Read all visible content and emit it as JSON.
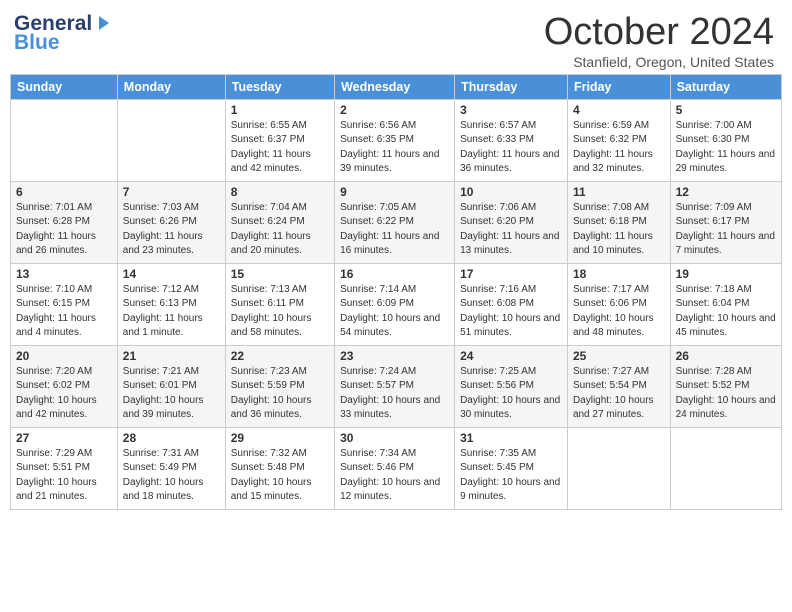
{
  "header": {
    "logo_general": "General",
    "logo_blue": "Blue",
    "month": "October 2024",
    "location": "Stanfield, Oregon, United States"
  },
  "days_of_week": [
    "Sunday",
    "Monday",
    "Tuesday",
    "Wednesday",
    "Thursday",
    "Friday",
    "Saturday"
  ],
  "weeks": [
    [
      {
        "day": "",
        "sunrise": "",
        "sunset": "",
        "daylight": ""
      },
      {
        "day": "",
        "sunrise": "",
        "sunset": "",
        "daylight": ""
      },
      {
        "day": "1",
        "sunrise": "Sunrise: 6:55 AM",
        "sunset": "Sunset: 6:37 PM",
        "daylight": "Daylight: 11 hours and 42 minutes."
      },
      {
        "day": "2",
        "sunrise": "Sunrise: 6:56 AM",
        "sunset": "Sunset: 6:35 PM",
        "daylight": "Daylight: 11 hours and 39 minutes."
      },
      {
        "day": "3",
        "sunrise": "Sunrise: 6:57 AM",
        "sunset": "Sunset: 6:33 PM",
        "daylight": "Daylight: 11 hours and 36 minutes."
      },
      {
        "day": "4",
        "sunrise": "Sunrise: 6:59 AM",
        "sunset": "Sunset: 6:32 PM",
        "daylight": "Daylight: 11 hours and 32 minutes."
      },
      {
        "day": "5",
        "sunrise": "Sunrise: 7:00 AM",
        "sunset": "Sunset: 6:30 PM",
        "daylight": "Daylight: 11 hours and 29 minutes."
      }
    ],
    [
      {
        "day": "6",
        "sunrise": "Sunrise: 7:01 AM",
        "sunset": "Sunset: 6:28 PM",
        "daylight": "Daylight: 11 hours and 26 minutes."
      },
      {
        "day": "7",
        "sunrise": "Sunrise: 7:03 AM",
        "sunset": "Sunset: 6:26 PM",
        "daylight": "Daylight: 11 hours and 23 minutes."
      },
      {
        "day": "8",
        "sunrise": "Sunrise: 7:04 AM",
        "sunset": "Sunset: 6:24 PM",
        "daylight": "Daylight: 11 hours and 20 minutes."
      },
      {
        "day": "9",
        "sunrise": "Sunrise: 7:05 AM",
        "sunset": "Sunset: 6:22 PM",
        "daylight": "Daylight: 11 hours and 16 minutes."
      },
      {
        "day": "10",
        "sunrise": "Sunrise: 7:06 AM",
        "sunset": "Sunset: 6:20 PM",
        "daylight": "Daylight: 11 hours and 13 minutes."
      },
      {
        "day": "11",
        "sunrise": "Sunrise: 7:08 AM",
        "sunset": "Sunset: 6:18 PM",
        "daylight": "Daylight: 11 hours and 10 minutes."
      },
      {
        "day": "12",
        "sunrise": "Sunrise: 7:09 AM",
        "sunset": "Sunset: 6:17 PM",
        "daylight": "Daylight: 11 hours and 7 minutes."
      }
    ],
    [
      {
        "day": "13",
        "sunrise": "Sunrise: 7:10 AM",
        "sunset": "Sunset: 6:15 PM",
        "daylight": "Daylight: 11 hours and 4 minutes."
      },
      {
        "day": "14",
        "sunrise": "Sunrise: 7:12 AM",
        "sunset": "Sunset: 6:13 PM",
        "daylight": "Daylight: 11 hours and 1 minute."
      },
      {
        "day": "15",
        "sunrise": "Sunrise: 7:13 AM",
        "sunset": "Sunset: 6:11 PM",
        "daylight": "Daylight: 10 hours and 58 minutes."
      },
      {
        "day": "16",
        "sunrise": "Sunrise: 7:14 AM",
        "sunset": "Sunset: 6:09 PM",
        "daylight": "Daylight: 10 hours and 54 minutes."
      },
      {
        "day": "17",
        "sunrise": "Sunrise: 7:16 AM",
        "sunset": "Sunset: 6:08 PM",
        "daylight": "Daylight: 10 hours and 51 minutes."
      },
      {
        "day": "18",
        "sunrise": "Sunrise: 7:17 AM",
        "sunset": "Sunset: 6:06 PM",
        "daylight": "Daylight: 10 hours and 48 minutes."
      },
      {
        "day": "19",
        "sunrise": "Sunrise: 7:18 AM",
        "sunset": "Sunset: 6:04 PM",
        "daylight": "Daylight: 10 hours and 45 minutes."
      }
    ],
    [
      {
        "day": "20",
        "sunrise": "Sunrise: 7:20 AM",
        "sunset": "Sunset: 6:02 PM",
        "daylight": "Daylight: 10 hours and 42 minutes."
      },
      {
        "day": "21",
        "sunrise": "Sunrise: 7:21 AM",
        "sunset": "Sunset: 6:01 PM",
        "daylight": "Daylight: 10 hours and 39 minutes."
      },
      {
        "day": "22",
        "sunrise": "Sunrise: 7:23 AM",
        "sunset": "Sunset: 5:59 PM",
        "daylight": "Daylight: 10 hours and 36 minutes."
      },
      {
        "day": "23",
        "sunrise": "Sunrise: 7:24 AM",
        "sunset": "Sunset: 5:57 PM",
        "daylight": "Daylight: 10 hours and 33 minutes."
      },
      {
        "day": "24",
        "sunrise": "Sunrise: 7:25 AM",
        "sunset": "Sunset: 5:56 PM",
        "daylight": "Daylight: 10 hours and 30 minutes."
      },
      {
        "day": "25",
        "sunrise": "Sunrise: 7:27 AM",
        "sunset": "Sunset: 5:54 PM",
        "daylight": "Daylight: 10 hours and 27 minutes."
      },
      {
        "day": "26",
        "sunrise": "Sunrise: 7:28 AM",
        "sunset": "Sunset: 5:52 PM",
        "daylight": "Daylight: 10 hours and 24 minutes."
      }
    ],
    [
      {
        "day": "27",
        "sunrise": "Sunrise: 7:29 AM",
        "sunset": "Sunset: 5:51 PM",
        "daylight": "Daylight: 10 hours and 21 minutes."
      },
      {
        "day": "28",
        "sunrise": "Sunrise: 7:31 AM",
        "sunset": "Sunset: 5:49 PM",
        "daylight": "Daylight: 10 hours and 18 minutes."
      },
      {
        "day": "29",
        "sunrise": "Sunrise: 7:32 AM",
        "sunset": "Sunset: 5:48 PM",
        "daylight": "Daylight: 10 hours and 15 minutes."
      },
      {
        "day": "30",
        "sunrise": "Sunrise: 7:34 AM",
        "sunset": "Sunset: 5:46 PM",
        "daylight": "Daylight: 10 hours and 12 minutes."
      },
      {
        "day": "31",
        "sunrise": "Sunrise: 7:35 AM",
        "sunset": "Sunset: 5:45 PM",
        "daylight": "Daylight: 10 hours and 9 minutes."
      },
      {
        "day": "",
        "sunrise": "",
        "sunset": "",
        "daylight": ""
      },
      {
        "day": "",
        "sunrise": "",
        "sunset": "",
        "daylight": ""
      }
    ]
  ]
}
